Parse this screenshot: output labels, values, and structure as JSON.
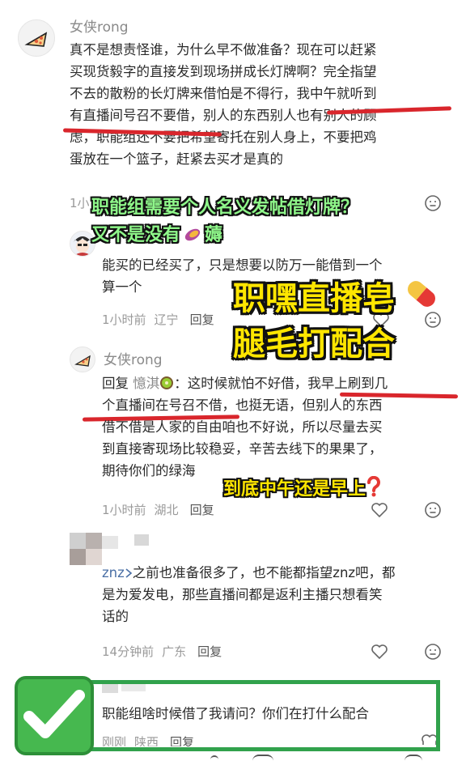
{
  "c1": {
    "username": "女侠rong",
    "lines": [
      "真不是想责怪谁，为什么早不做准备？现在可以赶紧",
      "买现货毅字的直接发到现场拼成长灯牌啊？完全指望",
      "不去的散粉的长灯牌来借怕是不得行，我中午就听到",
      "有直播间号召不要借，别人的东西别人也有别人的顾",
      "虑，职能组还不要把希望寄托在别人身上，不要把鸡",
      "蛋放在一个篮子，赶紧去买才是真的"
    ],
    "time_fragment": "1小"
  },
  "c2": {
    "lines": [
      "能买的已经买了，只是想要以防万一能借到一个",
      "算一个"
    ],
    "time": "1小时前",
    "location": "辽宁",
    "reply": "回复"
  },
  "c3": {
    "username": "女侠rong",
    "reply_prefix": "回复",
    "reply_target": "憶淇",
    "line1_rest": "：这时候就怕不好借，我早上刷到几",
    "lines": [
      "个直播间在号召不借，也挺无语，但别人的东西",
      "借不借是人家的自由咱也不好说，所以尽量去买",
      "到直接寄现场比较稳妥，辛苦去线下的果果了，",
      "期待你们的绿海"
    ],
    "time": "1小时前",
    "location": "湖北",
    "reply": "回复"
  },
  "c4": {
    "mention": "znz",
    "lines": [
      "之前也准备很多了，也不能都指望znz吧，都",
      "是为爱发电，那些直播间都是返利主播只想看笑",
      "话的"
    ],
    "time": "14分钟前",
    "location": "广东",
    "reply": "回复"
  },
  "c5": {
    "text": "职能组啥时候借了我请问？你们在打什么配合",
    "time_fragment": "刚刚",
    "location_fragment": "陕西",
    "reply_fragment": "回复"
  },
  "overlays": {
    "green_line1": "职能组需要个人名义发帖借灯牌？",
    "green_line2": "又不是没有",
    "green_line2_end": "薅",
    "yellow_line1": "职嘿直播皂",
    "yellow_line2": "腿毛打配合",
    "question": "到底中午还是早上"
  },
  "colors": {
    "underline": "#d9262c",
    "green_box": "#31a24c",
    "green_text": "#8ff78a",
    "yellow_text": "#ffe600"
  }
}
